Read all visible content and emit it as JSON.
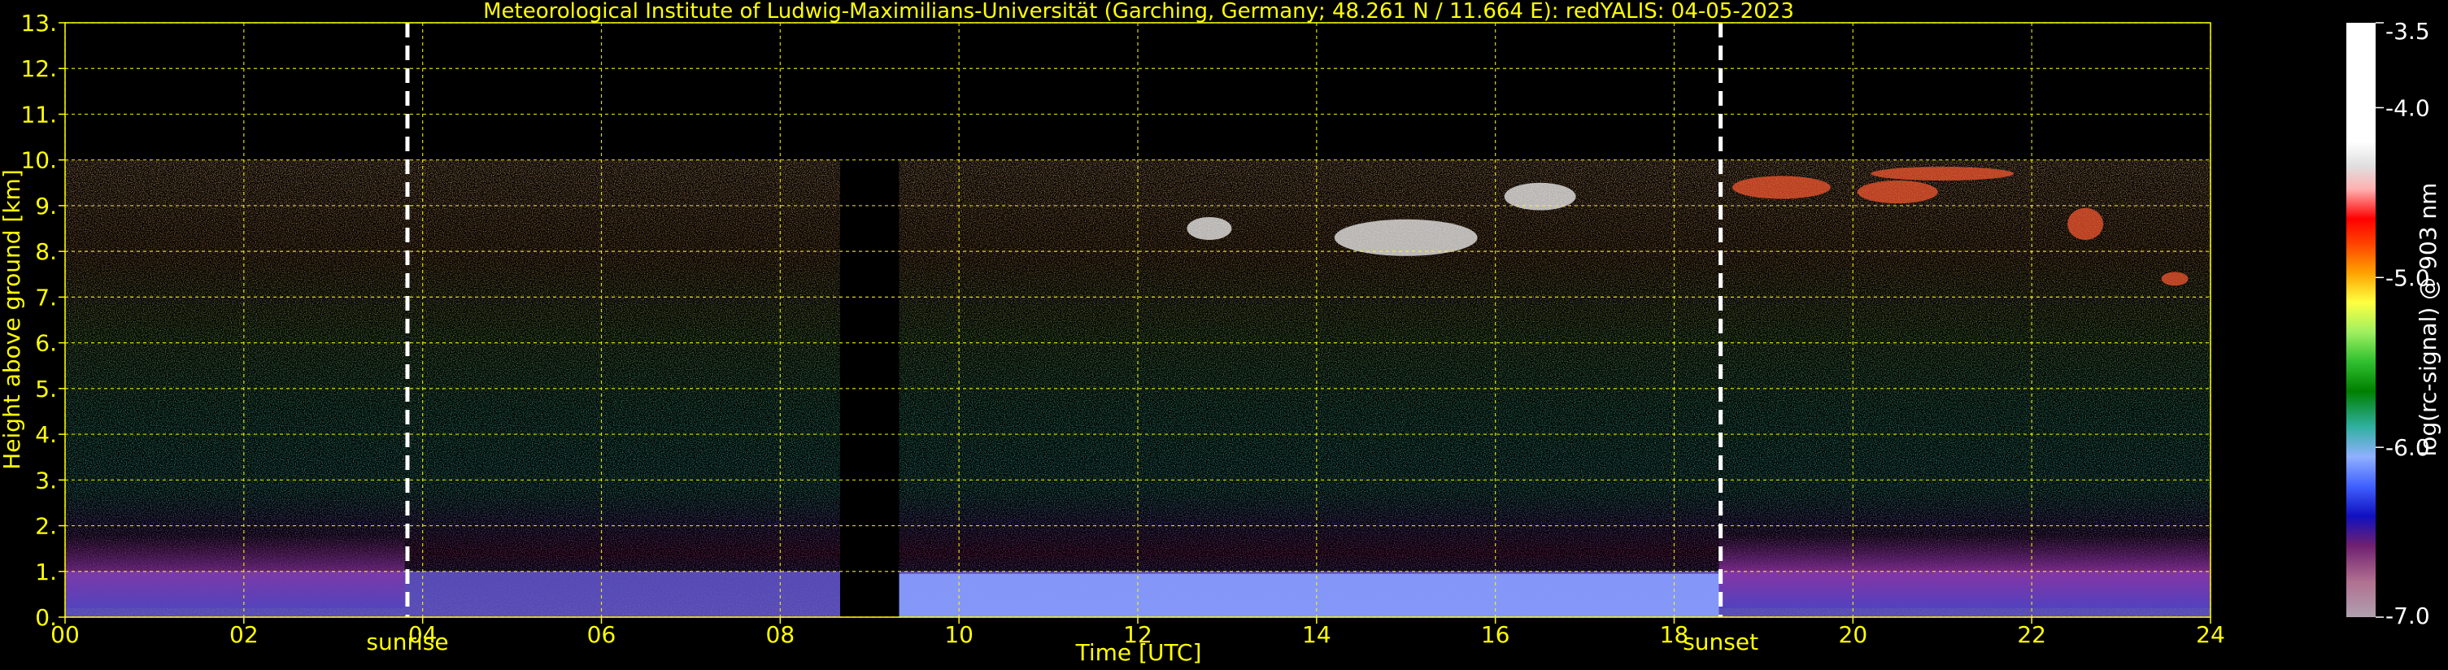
{
  "chart_data": {
    "type": "heatmap",
    "title": "Meteorological Institute of Ludwig-Maximilians-Universität (Garching, Germany; 48.261 N / 11.664 E):    redYALIS: 04-05-2023",
    "xlabel": "Time [UTC]",
    "ylabel": "Height above ground [km]",
    "xlim": [
      0,
      24
    ],
    "ylim": [
      0,
      13
    ],
    "x_ticks": [
      "00",
      "02",
      "04",
      "06",
      "08",
      "10",
      "12",
      "14",
      "16",
      "18",
      "20",
      "22",
      "24"
    ],
    "y_ticks": [
      "0.",
      "1.",
      "2.",
      "3.",
      "4.",
      "5.",
      "6.",
      "7.",
      "8.",
      "9.",
      "10.",
      "11.",
      "12.",
      "13."
    ],
    "grid": true,
    "data_top_km": 10,
    "gap_hours": [
      8.67,
      9.33
    ],
    "annotations": [
      {
        "text": "sunrise",
        "x": 3.83
      },
      {
        "text": "sunset",
        "x": 18.52
      }
    ],
    "colorbar": {
      "label": "log(rc-signal) @ 903 nm",
      "range": [
        -7.0,
        -3.5
      ],
      "ticks": [
        "-3.5",
        "-4.0",
        "-5.0",
        "-6.0",
        "-7.0"
      ],
      "tick_values": [
        -3.5,
        -4.0,
        -5.0,
        -6.0,
        -7.0
      ]
    },
    "colors": {
      "axis": "#ffff00",
      "grid": "#ffff00",
      "markers": "#ffffff",
      "background": "#000000"
    }
  }
}
